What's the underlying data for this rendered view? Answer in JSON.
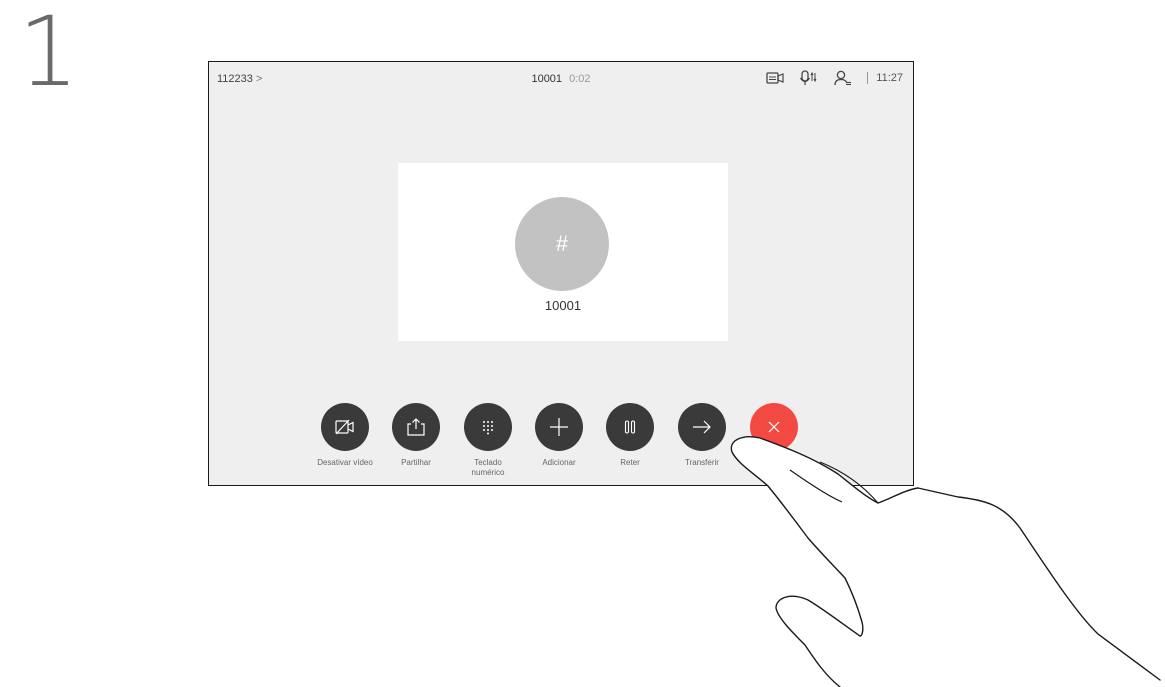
{
  "step": {
    "number": "1"
  },
  "status_bar": {
    "left_label": "112233",
    "left_chevron": ">",
    "call_number": "10001",
    "call_duration": "0:02",
    "time": "11:27",
    "icons": [
      "selfview-icon",
      "mic-icon",
      "participants-icon"
    ]
  },
  "call_card": {
    "avatar_symbol": "#",
    "name": "10001"
  },
  "controls": [
    {
      "id": "video-off",
      "label": "Desativar vídeo",
      "icon": "video-off-icon"
    },
    {
      "id": "share",
      "label": "Partilhar",
      "icon": "share-icon"
    },
    {
      "id": "keypad",
      "label": "Teclado numérico",
      "icon": "keypad-icon"
    },
    {
      "id": "add",
      "label": "Adicionar",
      "icon": "plus-icon"
    },
    {
      "id": "hold",
      "label": "Reter",
      "icon": "pause-icon"
    },
    {
      "id": "transfer",
      "label": "Transferir",
      "icon": "arrow-right-icon"
    },
    {
      "id": "end-call",
      "label": "",
      "icon": "close-icon"
    }
  ],
  "colors": {
    "screen_bg": "#efefef",
    "button_dark": "#3a3a3a",
    "end_call_red": "#f24a43",
    "avatar_gray": "#c2c2c2"
  }
}
